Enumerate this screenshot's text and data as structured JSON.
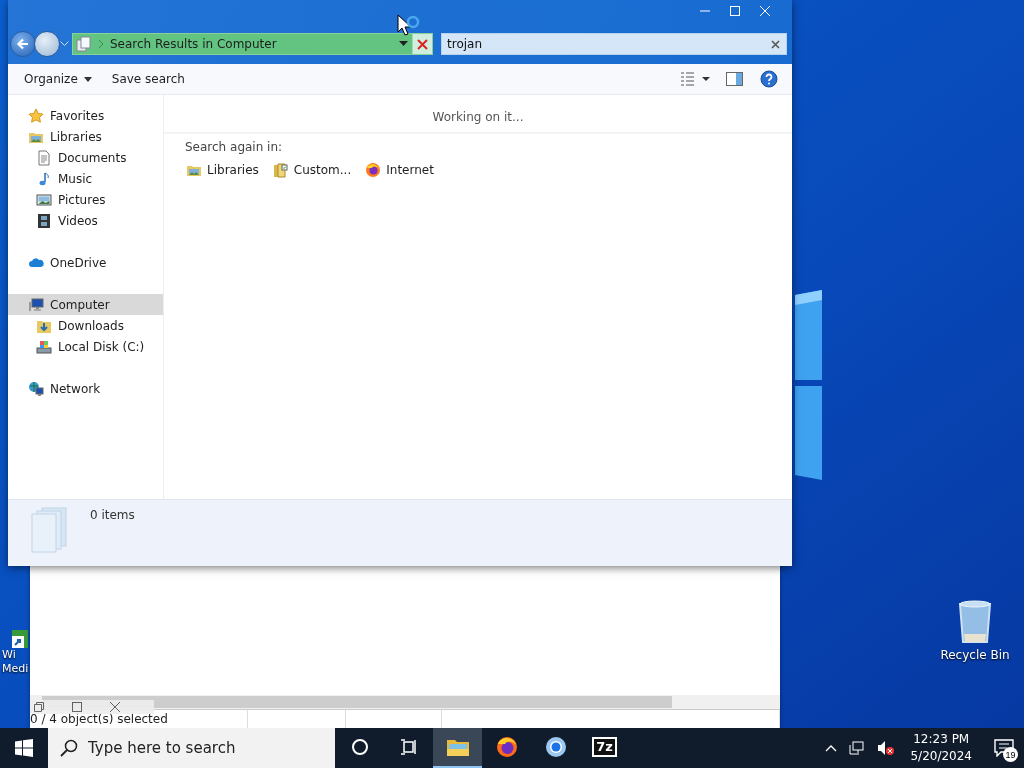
{
  "desktop": {
    "icons": [
      {
        "label": "Recycle Bin"
      }
    ],
    "partial_icon": {
      "label_lines": [
        "Wi",
        "Medi"
      ]
    }
  },
  "back_window": {
    "status": "0 / 4 object(s) selected"
  },
  "explorer": {
    "address": "Search Results in Computer",
    "search": {
      "value": "trojan"
    },
    "toolbar": [
      {
        "label": "Organize",
        "dropdown": true
      },
      {
        "label": "Save search",
        "dropdown": false
      }
    ],
    "nav": [
      {
        "label": "Favorites",
        "kind": "star",
        "selected": false
      },
      {
        "label": "Libraries",
        "kind": "library",
        "selected": false,
        "children": [
          {
            "label": "Documents",
            "kind": "document",
            "selected": false
          },
          {
            "label": "Music",
            "kind": "music",
            "selected": false
          },
          {
            "label": "Pictures",
            "kind": "pictures",
            "selected": false
          },
          {
            "label": "Videos",
            "kind": "videos",
            "selected": false
          }
        ]
      },
      {
        "label": "OneDrive",
        "kind": "cloud",
        "selected": false
      },
      {
        "label": "Computer",
        "kind": "computer",
        "selected": true,
        "children": [
          {
            "label": "Downloads",
            "kind": "downloads",
            "selected": false
          },
          {
            "label": "Local Disk (C:)",
            "kind": "disk",
            "selected": false
          }
        ]
      },
      {
        "label": "Network",
        "kind": "network",
        "selected": false
      }
    ],
    "status": "Working on it...",
    "search_again": {
      "label": "Search again in:",
      "options": [
        {
          "label": "Libraries",
          "kind": "library"
        },
        {
          "label": "Custom...",
          "kind": "custom"
        },
        {
          "label": "Internet",
          "kind": "internet"
        }
      ]
    },
    "details": {
      "count": "0 items"
    }
  },
  "taskbar": {
    "search": {
      "placeholder": "Type here to search"
    },
    "apps": [
      {
        "kind": "cortana",
        "selected": false
      },
      {
        "kind": "task-view",
        "selected": false
      },
      {
        "kind": "explorer",
        "selected": true
      },
      {
        "kind": "firefox",
        "selected": false
      },
      {
        "kind": "chrome",
        "selected": false
      },
      {
        "kind": "archiver",
        "label": "7z",
        "selected": false
      }
    ],
    "clock": {
      "time": "12:23 PM",
      "date": "5/20/2024"
    },
    "notifications": {
      "badge": "19"
    }
  }
}
